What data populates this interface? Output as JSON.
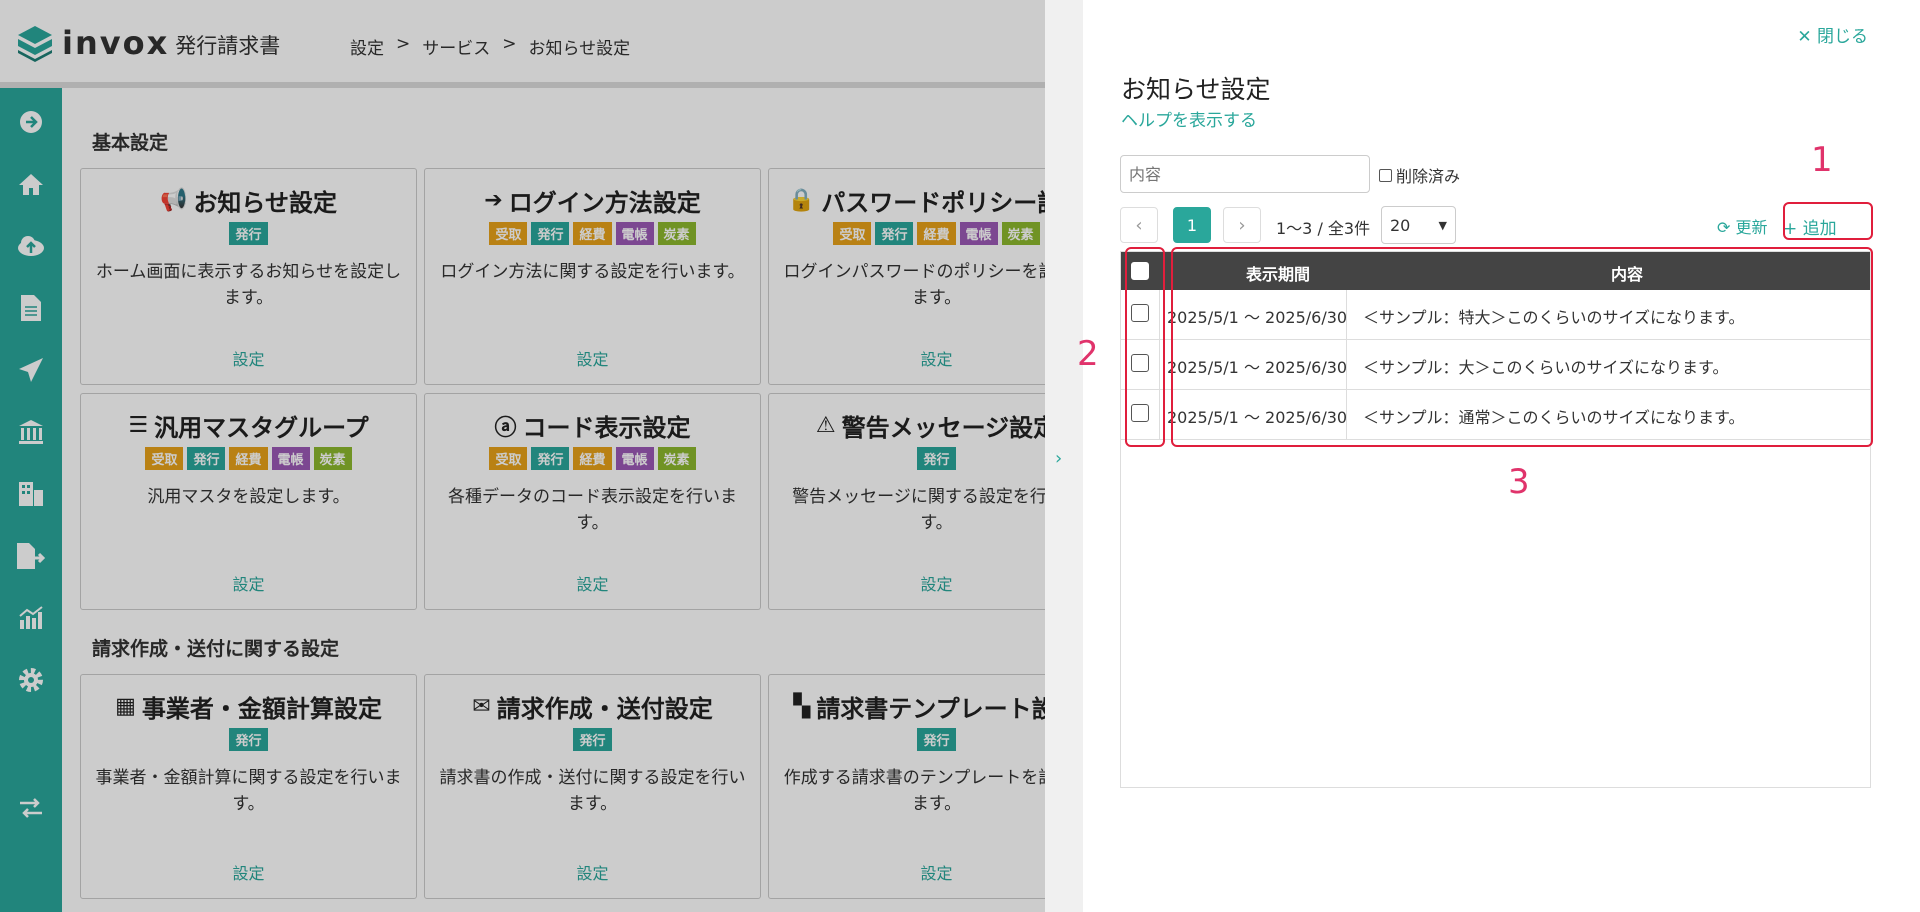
{
  "header": {
    "logo_text": "invox",
    "logo_sub": "発行請求書",
    "breadcrumb": [
      "設定",
      ">",
      "サービス",
      ">",
      "お知らせ設定"
    ]
  },
  "sidebar": {
    "icons": [
      "arrow-right-circle-icon",
      "home-icon",
      "cloud-upload-icon",
      "document-icon",
      "send-icon",
      "bank-icon",
      "building-icon",
      "file-export-icon",
      "chart-icon",
      "gear-icon",
      "exchange-icon"
    ]
  },
  "sections": {
    "basic": "基本設定",
    "invoice": "請求作成・送付に関する設定"
  },
  "cards": [
    {
      "title": "お知らせ設定",
      "icon": "📢",
      "badges": [
        "発行"
      ],
      "desc": "ホーム画面に表示するお知らせを設定します。",
      "link": "設定"
    },
    {
      "title": "ログイン方法設定",
      "icon": "➔",
      "badges": [
        "受取",
        "発行",
        "経費",
        "電帳",
        "炭素"
      ],
      "desc": "ログイン方法に関する設定を行います。",
      "link": "設定"
    },
    {
      "title": "パスワードポリシー設定",
      "icon": "🔒",
      "badges": [
        "受取",
        "発行",
        "経費",
        "電帳",
        "炭素"
      ],
      "desc": "ログインパスワードのポリシーを設定します。",
      "link": "設定"
    },
    {
      "title": "汎用マスタグループ",
      "icon": "☰",
      "badges": [
        "受取",
        "発行",
        "経費",
        "電帳",
        "炭素"
      ],
      "desc": "汎用マスタを設定します。",
      "link": "設定"
    },
    {
      "title": "コード表示設定",
      "icon": "ⓐ",
      "badges": [
        "受取",
        "発行",
        "経費",
        "電帳",
        "炭素"
      ],
      "desc": "各種データのコード表示設定を行います。",
      "link": "設定"
    },
    {
      "title": "警告メッセージ設定",
      "icon": "⚠",
      "badges": [
        "発行"
      ],
      "desc": "警告メッセージに関する設定を行います。",
      "link": "設定"
    },
    {
      "title": "事業者・金額計算設定",
      "icon": "▦",
      "badges": [
        "発行"
      ],
      "desc": "事業者・金額計算に関する設定を行います。",
      "link": "設定"
    },
    {
      "title": "請求作成・送付設定",
      "icon": "✉",
      "badges": [
        "発行"
      ],
      "desc": "請求書の作成・送付に関する設定を行います。",
      "link": "設定"
    },
    {
      "title": "請求書テンプレート設定",
      "icon": "▚",
      "badges": [
        "発行"
      ],
      "desc": "作成する請求書のテンプレートを設定します。",
      "link": "設定"
    }
  ],
  "badge_colors": {
    "受取": "#e8a21a",
    "発行": "#2aa79b",
    "経費": "#e8a21a",
    "電帳": "#9b59b6",
    "炭素": "#8cb82e"
  },
  "panel": {
    "close": "✕ 閉じる",
    "title": "お知らせ設定",
    "help": "ヘルプを表示する",
    "search_placeholder": "内容",
    "deleted_label": "削除済み",
    "page": "1",
    "page_info": "1〜3 / 全3件",
    "page_size": "20",
    "refresh": "⟳ 更新",
    "add": "+ 追加",
    "col_period": "表示期間",
    "col_content": "内容",
    "rows": [
      {
        "period": "2025/5/1 〜 2025/6/30",
        "content": "＜サンプル：特大＞このくらいのサイズになります。"
      },
      {
        "period": "2025/5/1 〜 2025/6/30",
        "content": "＜サンプル：大＞このくらいのサイズになります。"
      },
      {
        "period": "2025/5/1 〜 2025/6/30",
        "content": "＜サンプル：通常＞このくらいのサイズになります。"
      }
    ]
  },
  "annotations": [
    "1",
    "2",
    "3"
  ]
}
